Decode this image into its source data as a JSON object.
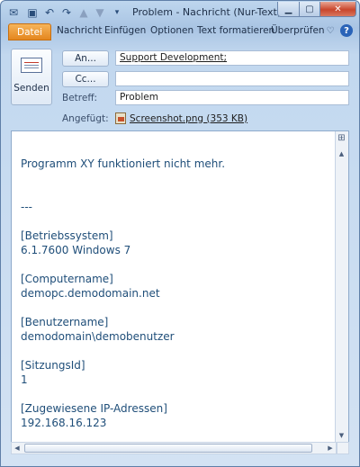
{
  "window": {
    "title": "Problem  -  Nachricht (Nur-Text)",
    "minimize_icon": "minimize-icon",
    "maximize_icon": "maximize-icon",
    "close_icon": "close-icon"
  },
  "ribbon": {
    "tabs": [
      "Datei",
      "Nachricht",
      "Einfügen",
      "Optionen",
      "Text formatieren",
      "Überprüfen"
    ],
    "file_tab_color": "#e4861e"
  },
  "compose": {
    "send_label": "Senden",
    "to_button": "An...",
    "cc_button": "Cc...",
    "to_value": "Support Development;",
    "cc_value": "",
    "subject_label": "Betreff:",
    "subject_value": "Problem",
    "attached_label": "Angefügt:",
    "attachment": "Screenshot.png (353 KB)"
  },
  "message": {
    "text_color": "#1f4e79",
    "lines": [
      "Programm XY funktioniert nicht mehr.",
      "",
      "",
      "---",
      "",
      "[Betriebssystem]",
      "6.1.7600 Windows 7",
      "",
      "[Computername]",
      "demopc.demodomain.net",
      "",
      "[Benutzername]",
      "demodomain\\demobenutzer",
      "",
      "[SitzungsId]",
      "1",
      "",
      "[Zugewiesene IP-Adressen]",
      "192.168.16.123"
    ]
  }
}
